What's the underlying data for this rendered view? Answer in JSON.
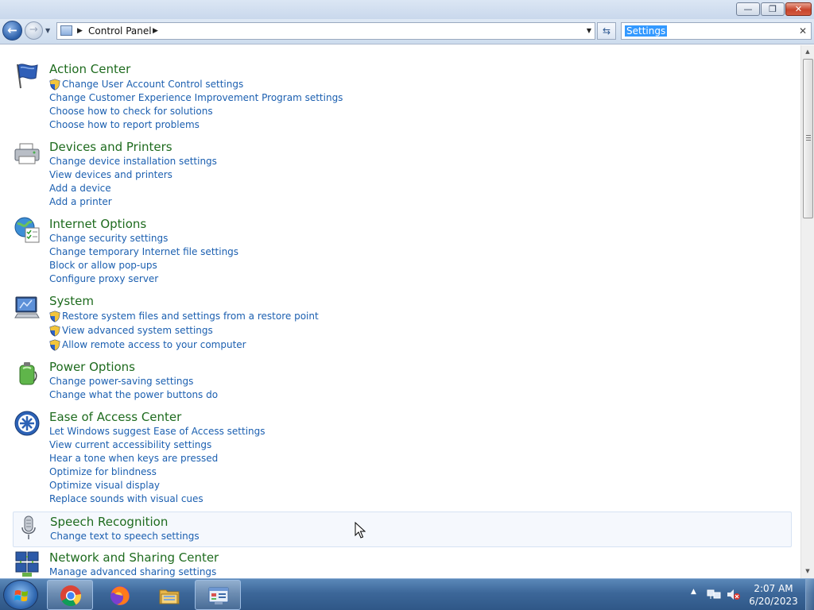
{
  "window": {
    "minimize_glyph": "—",
    "maximize_glyph": "❐",
    "close_glyph": "✕"
  },
  "nav": {
    "back_icon": "back-arrow-icon",
    "forward_icon": "forward-arrow-icon",
    "address": {
      "path_label": "Control Panel",
      "folder_icon": "control-panel-icon"
    },
    "search": {
      "value": "Settings",
      "clear_glyph": "✕"
    }
  },
  "groups": [
    {
      "title": "Action Center",
      "icon": "flag-icon",
      "links": [
        {
          "label": "Change User Account Control settings",
          "shield": true
        },
        {
          "label": "Change Customer Experience Improvement Program settings",
          "shield": false
        },
        {
          "label": "Choose how to check for solutions",
          "shield": false
        },
        {
          "label": "Choose how to report problems",
          "shield": false
        }
      ]
    },
    {
      "title": "Devices and Printers",
      "icon": "printer-icon",
      "links": [
        {
          "label": "Change device installation settings",
          "shield": false
        },
        {
          "label": "View devices and printers",
          "shield": false
        },
        {
          "label": "Add a device",
          "shield": false
        },
        {
          "label": "Add a printer",
          "shield": false
        }
      ]
    },
    {
      "title": "Internet Options",
      "icon": "globe-checklist-icon",
      "links": [
        {
          "label": "Change security settings",
          "shield": false
        },
        {
          "label": "Change temporary Internet file settings",
          "shield": false
        },
        {
          "label": "Block or allow pop-ups",
          "shield": false
        },
        {
          "label": "Configure proxy server",
          "shield": false
        }
      ]
    },
    {
      "title": "System",
      "icon": "computer-icon",
      "links": [
        {
          "label": "Restore system files and settings from a restore point",
          "shield": true
        },
        {
          "label": "View advanced system settings",
          "shield": true
        },
        {
          "label": "Allow remote access to your computer",
          "shield": true
        }
      ]
    },
    {
      "title": "Power Options",
      "icon": "battery-icon",
      "links": [
        {
          "label": "Change power-saving settings",
          "shield": false
        },
        {
          "label": "Change what the power buttons do",
          "shield": false
        }
      ]
    },
    {
      "title": "Ease of Access Center",
      "icon": "ease-of-access-icon",
      "links": [
        {
          "label": "Let Windows suggest Ease of Access settings",
          "shield": false
        },
        {
          "label": "View current accessibility settings",
          "shield": false
        },
        {
          "label": "Hear a tone when keys are pressed",
          "shield": false
        },
        {
          "label": "Optimize for blindness",
          "shield": false
        },
        {
          "label": "Optimize visual display",
          "shield": false
        },
        {
          "label": "Replace sounds with visual cues",
          "shield": false
        }
      ]
    },
    {
      "title": "Speech Recognition",
      "icon": "microphone-icon",
      "links": [
        {
          "label": "Change text to speech settings",
          "shield": false
        }
      ]
    },
    {
      "title": "Network and Sharing Center",
      "icon": "network-icon",
      "links": [
        {
          "label": "Manage advanced sharing settings",
          "shield": false
        }
      ]
    }
  ],
  "taskbar": {
    "start_icon": "windows-logo-icon",
    "pinned": [
      {
        "name": "chrome-icon",
        "active": true
      },
      {
        "name": "firefox-icon",
        "active": false
      },
      {
        "name": "file-explorer-icon",
        "active": false
      },
      {
        "name": "control-panel-icon",
        "active": true
      }
    ],
    "clock_time": "2:07 AM",
    "clock_date": "6/20/2023"
  },
  "colors": {
    "group_title": "#1e6b1e",
    "link": "#1b5fb0",
    "selection": "#3399ff"
  }
}
